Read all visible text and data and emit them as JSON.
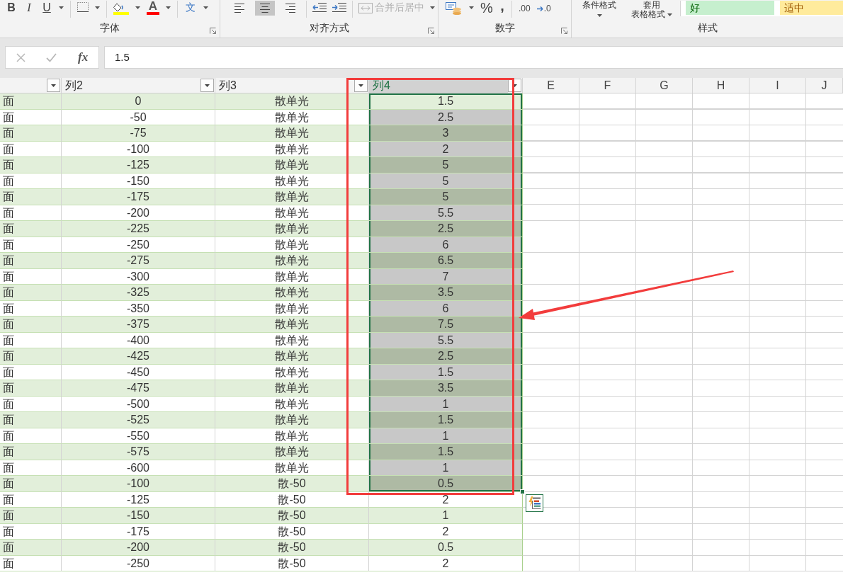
{
  "ribbon": {
    "font_group": {
      "label": "字体",
      "style_buttons": [
        {
          "kind": "bold",
          "text": "B"
        },
        {
          "kind": "italic",
          "text": "I"
        },
        {
          "kind": "underline",
          "text": "U"
        }
      ],
      "font_color_text": "A",
      "phonetic_text": "文"
    },
    "alignment_group": {
      "label": "对齐方式",
      "align_buttons": [
        {
          "kind": "left",
          "selected": false
        },
        {
          "kind": "center",
          "selected": true
        },
        {
          "kind": "right",
          "selected": false
        }
      ],
      "merge_button": {
        "label": "合并后居中",
        "disabled": true
      }
    },
    "number_group": {
      "label": "数字",
      "percent_text": "%",
      "comma_text": ",",
      "decimal_buttons": [
        {
          "kind": "increase",
          "text": ".00"
        },
        {
          "kind": "decrease",
          "text": ".0"
        }
      ]
    },
    "styles_group": {
      "label": "样式",
      "conditional_format": "条件格式",
      "table_format_top": "套用",
      "table_format": "表格格式",
      "cell_styles": [
        {
          "kind": "good",
          "label": "好"
        },
        {
          "kind": "neutral",
          "label": "适中"
        }
      ]
    }
  },
  "formula_bar": {
    "editing": false,
    "function_label": "fx",
    "value": "1.5"
  },
  "table": {
    "columns": [
      {
        "selected": false
      },
      {
        "label": "列2",
        "selected": false
      },
      {
        "label": "列3",
        "selected": false
      },
      {
        "label": "列4",
        "selected": true
      }
    ],
    "column_letters": [
      "E",
      "F",
      "G",
      "H",
      "I",
      "J"
    ],
    "rows": [
      {
        "cells": [
          "面",
          "0",
          "散单光",
          "1.5"
        ],
        "selected": true,
        "active": true
      },
      {
        "cells": [
          "面",
          "-50",
          "散单光",
          "2.5"
        ],
        "selected": true,
        "active": false
      },
      {
        "cells": [
          "面",
          "-75",
          "散单光",
          "3"
        ],
        "selected": true,
        "active": false
      },
      {
        "cells": [
          "面",
          "-100",
          "散单光",
          "2"
        ],
        "selected": true,
        "active": false
      },
      {
        "cells": [
          "面",
          "-125",
          "散单光",
          "5"
        ],
        "selected": true,
        "active": false
      },
      {
        "cells": [
          "面",
          "-150",
          "散单光",
          "5"
        ],
        "selected": true,
        "active": false
      },
      {
        "cells": [
          "面",
          "-175",
          "散单光",
          "5"
        ],
        "selected": true,
        "active": false
      },
      {
        "cells": [
          "面",
          "-200",
          "散单光",
          "5.5"
        ],
        "selected": true,
        "active": false
      },
      {
        "cells": [
          "面",
          "-225",
          "散单光",
          "2.5"
        ],
        "selected": true,
        "active": false
      },
      {
        "cells": [
          "面",
          "-250",
          "散单光",
          "6"
        ],
        "selected": true,
        "active": false
      },
      {
        "cells": [
          "面",
          "-275",
          "散单光",
          "6.5"
        ],
        "selected": true,
        "active": false
      },
      {
        "cells": [
          "面",
          "-300",
          "散单光",
          "7"
        ],
        "selected": true,
        "active": false
      },
      {
        "cells": [
          "面",
          "-325",
          "散单光",
          "3.5"
        ],
        "selected": true,
        "active": false
      },
      {
        "cells": [
          "面",
          "-350",
          "散单光",
          "6"
        ],
        "selected": true,
        "active": false
      },
      {
        "cells": [
          "面",
          "-375",
          "散单光",
          "7.5"
        ],
        "selected": true,
        "active": false
      },
      {
        "cells": [
          "面",
          "-400",
          "散单光",
          "5.5"
        ],
        "selected": true,
        "active": false
      },
      {
        "cells": [
          "面",
          "-425",
          "散单光",
          "2.5"
        ],
        "selected": true,
        "active": false
      },
      {
        "cells": [
          "面",
          "-450",
          "散单光",
          "1.5"
        ],
        "selected": true,
        "active": false
      },
      {
        "cells": [
          "面",
          "-475",
          "散单光",
          "3.5"
        ],
        "selected": true,
        "active": false
      },
      {
        "cells": [
          "面",
          "-500",
          "散单光",
          "1"
        ],
        "selected": true,
        "active": false
      },
      {
        "cells": [
          "面",
          "-525",
          "散单光",
          "1.5"
        ],
        "selected": true,
        "active": false
      },
      {
        "cells": [
          "面",
          "-550",
          "散单光",
          "1"
        ],
        "selected": true,
        "active": false
      },
      {
        "cells": [
          "面",
          "-575",
          "散单光",
          "1.5"
        ],
        "selected": true,
        "active": false
      },
      {
        "cells": [
          "面",
          "-600",
          "散单光",
          "1"
        ],
        "selected": true,
        "active": false
      },
      {
        "cells": [
          "面",
          "-100",
          "散-50",
          "0.5"
        ],
        "selected": true,
        "active": false
      },
      {
        "cells": [
          "面",
          "-125",
          "散-50",
          "2"
        ],
        "selected": false,
        "active": false
      },
      {
        "cells": [
          "面",
          "-150",
          "散-50",
          "1"
        ],
        "selected": false,
        "active": false
      },
      {
        "cells": [
          "面",
          "-175",
          "散-50",
          "2"
        ],
        "selected": false,
        "active": false
      },
      {
        "cells": [
          "面",
          "-200",
          "散-50",
          "0.5"
        ],
        "selected": false,
        "active": false
      },
      {
        "cells": [
          "面",
          "-250",
          "散-50",
          "2"
        ],
        "selected": false,
        "active": false
      }
    ]
  }
}
